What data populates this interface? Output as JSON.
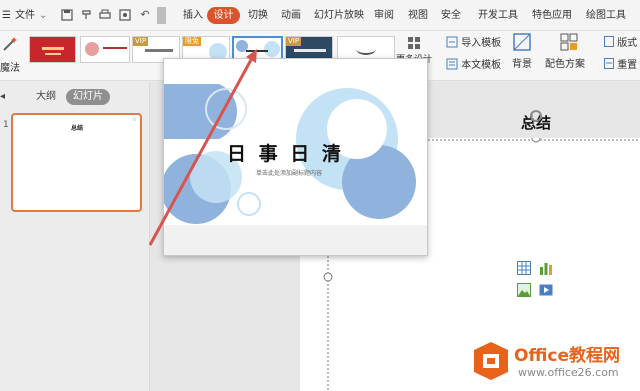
{
  "menubar": {
    "file_label": "文件",
    "tabs": [
      "插入",
      "设计",
      "切换",
      "动画",
      "幻灯片放映",
      "审阅",
      "视图",
      "安全",
      "开发工具",
      "特色应用",
      "绘图工具"
    ]
  },
  "ribbon": {
    "magic_label": "魔法",
    "vip_badge": "VIP",
    "free_badge": "限免",
    "more_design_label": "更多设计",
    "import_template_label": "导入模板",
    "body_template_label": "本文模板",
    "background_label": "背景",
    "color_scheme_label": "配色方案",
    "layout_label": "版式",
    "reset_label": "重置"
  },
  "left_panel": {
    "outline_tab": "大纲",
    "slides_tab": "幻灯片",
    "slide_number": "1",
    "slide_title": "总结"
  },
  "slide": {
    "title": "总结"
  },
  "preview": {
    "title": "日 事 日 清",
    "subtitle": "单击此处添加副标题内容"
  },
  "watermark": {
    "brand": "Office教程网",
    "url": "www.office26.com"
  },
  "colors": {
    "accent": "#d9542c",
    "arrow": "#d9534f",
    "bubble_dark": "#8fb3dd",
    "bubble_light": "#c4e2f5"
  }
}
